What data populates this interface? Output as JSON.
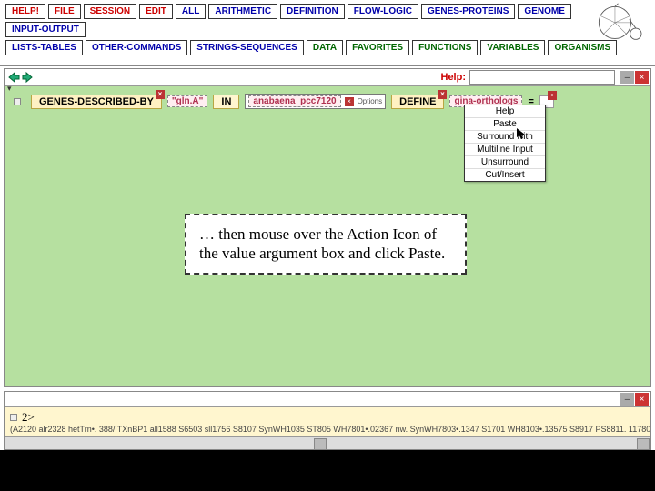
{
  "menu": {
    "row1": [
      "HELP!",
      "FILE",
      "SESSION",
      "EDIT",
      "ALL",
      "ARITHMETIC",
      "DEFINITION",
      "FLOW-LOGIC",
      "GENES-PROTEINS",
      "GENOME",
      "INPUT-OUTPUT"
    ],
    "row2": [
      "LISTS-TABLES",
      "OTHER-COMMANDS",
      "STRINGS-SEQUENCES",
      "DATA",
      "FAVORITES",
      "FUNCTIONS",
      "VARIABLES",
      "ORGANISMS"
    ],
    "colors1": [
      "red",
      "red",
      "red",
      "red",
      "blue",
      "blue",
      "blue",
      "blue",
      "blue",
      "blue",
      "blue"
    ],
    "colors2": [
      "blue",
      "blue",
      "blue",
      "green",
      "green",
      "green",
      "green",
      "green"
    ]
  },
  "header": {
    "help_label": "Help:"
  },
  "expression": {
    "func1": "GENES-DESCRIBED-BY",
    "arg1": "\"gln.A\"",
    "kw_in": "IN",
    "org": "anabaena_pcc7120",
    "options": "Options",
    "func2": "DEFINE",
    "var": "gina-orthologs",
    "eq": "="
  },
  "context_menu": [
    "Help",
    "Paste",
    "Surround with",
    "Multiline Input",
    "Unsurround",
    "Cut/Insert"
  ],
  "callout_text": "… then mouse over the Action Icon of the value argument box and click Paste.",
  "bottom": {
    "prompt": "2>",
    "output": "(A2120 alr2328 hetTrn•. 388/ TXnBP1 all1588 S6503 sll1756 S8107 SynWH1035 ST805 WH7801•.02367 nw. SynWH7803•.1347 S1701 WH8103•.13575 S8917 PS8811. 11780"
  }
}
